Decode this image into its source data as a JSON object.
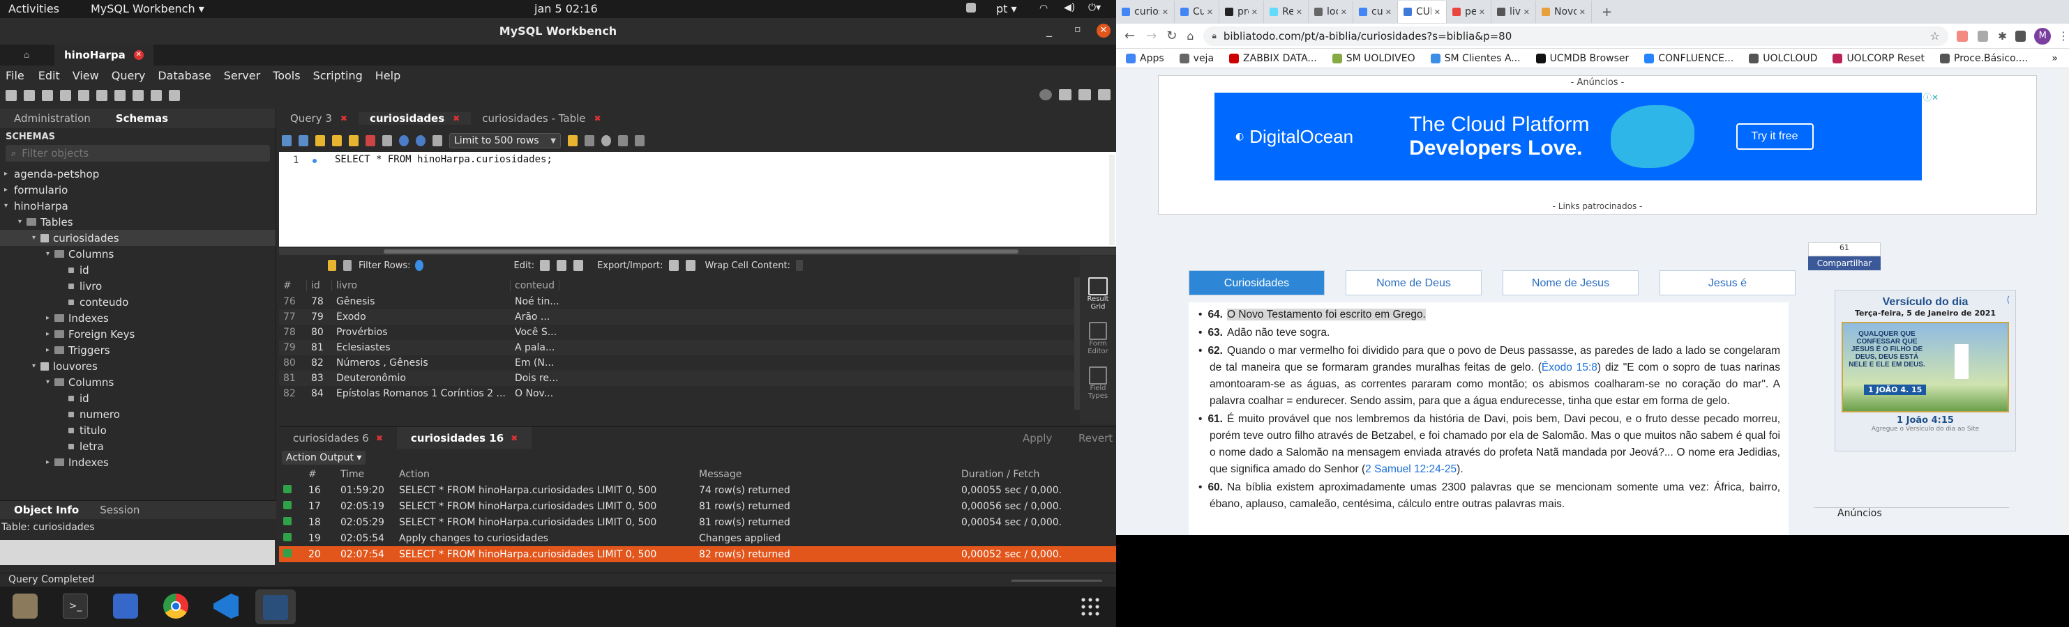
{
  "system": {
    "activities": "Activities",
    "app_menu": "MySQL Workbench ▾",
    "clock": "jan 5  02:16",
    "lang": "pt ▾"
  },
  "workbench": {
    "title": "MySQL Workbench",
    "conn_tab": "hinoHarpa",
    "menu": [
      "File",
      "Edit",
      "View",
      "Query",
      "Database",
      "Server",
      "Tools",
      "Scripting",
      "Help"
    ],
    "nav_tabs": [
      "Administration",
      "Schemas"
    ],
    "schemas_label": "SCHEMAS",
    "filter_placeholder": "Filter objects",
    "tree": [
      {
        "label": "agenda-petshop",
        "indent": 0,
        "arrow": "▸",
        "type": "db"
      },
      {
        "label": "formulario",
        "indent": 0,
        "arrow": "▸",
        "type": "db"
      },
      {
        "label": "hinoHarpa",
        "indent": 0,
        "arrow": "▾",
        "type": "db"
      },
      {
        "label": "Tables",
        "indent": 1,
        "arrow": "▾",
        "type": "folder"
      },
      {
        "label": "curiosidades",
        "indent": 2,
        "arrow": "▾",
        "type": "table",
        "selected": true
      },
      {
        "label": "Columns",
        "indent": 3,
        "arrow": "▾",
        "type": "folder"
      },
      {
        "label": "id",
        "indent": 4,
        "arrow": "",
        "type": "col"
      },
      {
        "label": "livro",
        "indent": 4,
        "arrow": "",
        "type": "col"
      },
      {
        "label": "conteudo",
        "indent": 4,
        "arrow": "",
        "type": "col"
      },
      {
        "label": "Indexes",
        "indent": 3,
        "arrow": "▸",
        "type": "folder"
      },
      {
        "label": "Foreign Keys",
        "indent": 3,
        "arrow": "▸",
        "type": "folder"
      },
      {
        "label": "Triggers",
        "indent": 3,
        "arrow": "▸",
        "type": "folder"
      },
      {
        "label": "louvores",
        "indent": 2,
        "arrow": "▾",
        "type": "table"
      },
      {
        "label": "Columns",
        "indent": 3,
        "arrow": "▾",
        "type": "folder"
      },
      {
        "label": "id",
        "indent": 4,
        "arrow": "",
        "type": "col"
      },
      {
        "label": "numero",
        "indent": 4,
        "arrow": "",
        "type": "col"
      },
      {
        "label": "titulo",
        "indent": 4,
        "arrow": "",
        "type": "col"
      },
      {
        "label": "letra",
        "indent": 4,
        "arrow": "",
        "type": "col"
      },
      {
        "label": "Indexes",
        "indent": 3,
        "arrow": "▸",
        "type": "folder"
      }
    ],
    "obj_tabs": [
      "Object Info",
      "Session"
    ],
    "obj_info": "Table: curiosidades",
    "editor_tabs": [
      "Query 3",
      "curiosidades",
      "curiosidades - Table"
    ],
    "limit": "Limit to 500 rows",
    "sql_line": "1",
    "sql": "SELECT * FROM hinoHarpa.curiosidades;",
    "result_toolbar": {
      "filter": "Filter Rows:",
      "edit": "Edit:",
      "export": "Export/Import:",
      "wrap": "Wrap Cell Content:"
    },
    "grid_headers": [
      "#",
      "id",
      "livro",
      "conteud"
    ],
    "grid_rows": [
      [
        "76",
        "78",
        "Gênesis",
        "Noé tin..."
      ],
      [
        "77",
        "79",
        "Êxodo",
        "Arão ..."
      ],
      [
        "78",
        "80",
        "Provérbios",
        "Você S..."
      ],
      [
        "79",
        "81",
        "Eclesiastes",
        "A pala..."
      ],
      [
        "80",
        "82",
        "Números , Gênesis",
        "Em (N..."
      ],
      [
        "81",
        "83",
        "Deuteronômio",
        "Dois re..."
      ],
      [
        "82",
        "84",
        "Epístolas Romanos 1 Coríntios 2 ...",
        "O Nov..."
      ]
    ],
    "side_panel": [
      "Result Grid",
      "Form Editor",
      "Field Types"
    ],
    "result_tabs": [
      "curiosidades 6",
      "curiosidades 16"
    ],
    "apply": "Apply",
    "revert": "Revert",
    "output_select": "Action Output ▾",
    "hist_headers": [
      "#",
      "Time",
      "Action",
      "Message",
      "Duration / Fetch"
    ],
    "history": [
      [
        "16",
        "01:59:20",
        "SELECT * FROM hinoHarpa.curiosidades LIMIT 0, 500",
        "74 row(s) returned",
        "0,00055 sec / 0,000..."
      ],
      [
        "17",
        "02:05:19",
        "SELECT * FROM hinoHarpa.curiosidades LIMIT 0, 500",
        "81 row(s) returned",
        "0,00056 sec / 0,000..."
      ],
      [
        "18",
        "02:05:29",
        "SELECT * FROM hinoHarpa.curiosidades LIMIT 0, 500",
        "81 row(s) returned",
        "0,00054 sec / 0,000..."
      ],
      [
        "19",
        "02:05:54",
        "Apply changes to curiosidades",
        "Changes applied",
        ""
      ],
      [
        "20",
        "02:07:54",
        "SELECT * FROM hinoHarpa.curiosidades LIMIT 0, 500",
        "82 row(s) returned",
        "0,00052 sec / 0,000..."
      ]
    ],
    "status": "Query Completed"
  },
  "browser": {
    "tabs": [
      "curiosi",
      "Curiosi",
      "proj-bibli",
      "React A",
      "localho",
      "curiosi",
      "CURIO",
      "pentat",
      "livros n",
      "Novo T"
    ],
    "active_tab": 6,
    "url": "bibliatodo.com/pt/a-biblia/curiosidades?s=biblia&p=80",
    "bookmarks": [
      "Apps",
      "veja",
      "ZABBIX DATA...",
      "SM UOLDIVEO",
      "SM Clientes A...",
      "UCMDB Browser",
      "CONFLUENCE...",
      "UOLCLOUD",
      "UOLCORP Reset",
      "Proce.Básico...."
    ],
    "ads_label": "- Anúncios -",
    "ad": {
      "brand": "DigitalOcean",
      "headline": "The Cloud Platform",
      "sub": "Developers Love.",
      "cta": "Try it free"
    },
    "sponsored": "- Links patrocinados -",
    "share_count": "61",
    "share_label": "Compartilhar",
    "nav": [
      "Curiosidades",
      "Nome de Deus",
      "Nome de Jesus",
      "Jesus é"
    ],
    "items": [
      {
        "num": "64.",
        "text": "O Novo Testamento foi escrito em Grego."
      },
      {
        "num": "63.",
        "text": "Adão não teve sogra."
      },
      {
        "num": "62.",
        "text": "Quando o mar vermelho foi dividido para que o povo de Deus passasse, as paredes de lado a lado se congelaram de tal maneira que se formaram grandes muralhas feitas de gelo. (",
        "link": "Êxodo 15:8",
        "after": ") diz \"E com o sopro de tuas narinas amontoaram-se as águas, as correntes pararam como montão; os abismos coalharam-se no coração do mar\". A palavra coalhar = endurecer. Sendo assim, para que a água endurecesse, tinha que estar em forma de gelo."
      },
      {
        "num": "61.",
        "text": "É muito provável que nos lembremos da história de Davi, pois bem, Davi pecou, e o fruto desse pecado morreu, porém teve outro filho através de Betzabel, e foi chamado por ela de Salomão. Mas o que muitos não sabem é qual foi o nome dado a Salomão na mensagem enviada através do profeta Natã mandada por Jeová?... O nome era Jedidias, que significa amado do Senhor (",
        "link": "2 Samuel 12:24-25",
        "after": ")."
      },
      {
        "num": "60.",
        "text": "Na bíblia existem aproximadamente umas 2300 palavras que se mencionam somente uma vez: África, bairro, ébano, aplauso, camaleão, centésima, cálculo entre outras palavras mais."
      }
    ],
    "verse": {
      "title": "Versículo do dia",
      "date": "Terça-feira, 5 de Janeiro de 2021",
      "img_text": "QUALQUER QUE CONFESSAR QUE JESUS É O FILHO DE DEUS, DEUS ESTÁ NELE E ELE EM DEUS.",
      "img_ref": "1 JOÃO 4. 15",
      "ref": "1 João 4:15",
      "add": "Agregue o Versículo do dia ao Site"
    },
    "ads_bottom": "Anúncios"
  },
  "colors": {
    "accent": "#e2561c",
    "chrome_blue": "#2d87d6",
    "do_blue": "#0069ff"
  }
}
